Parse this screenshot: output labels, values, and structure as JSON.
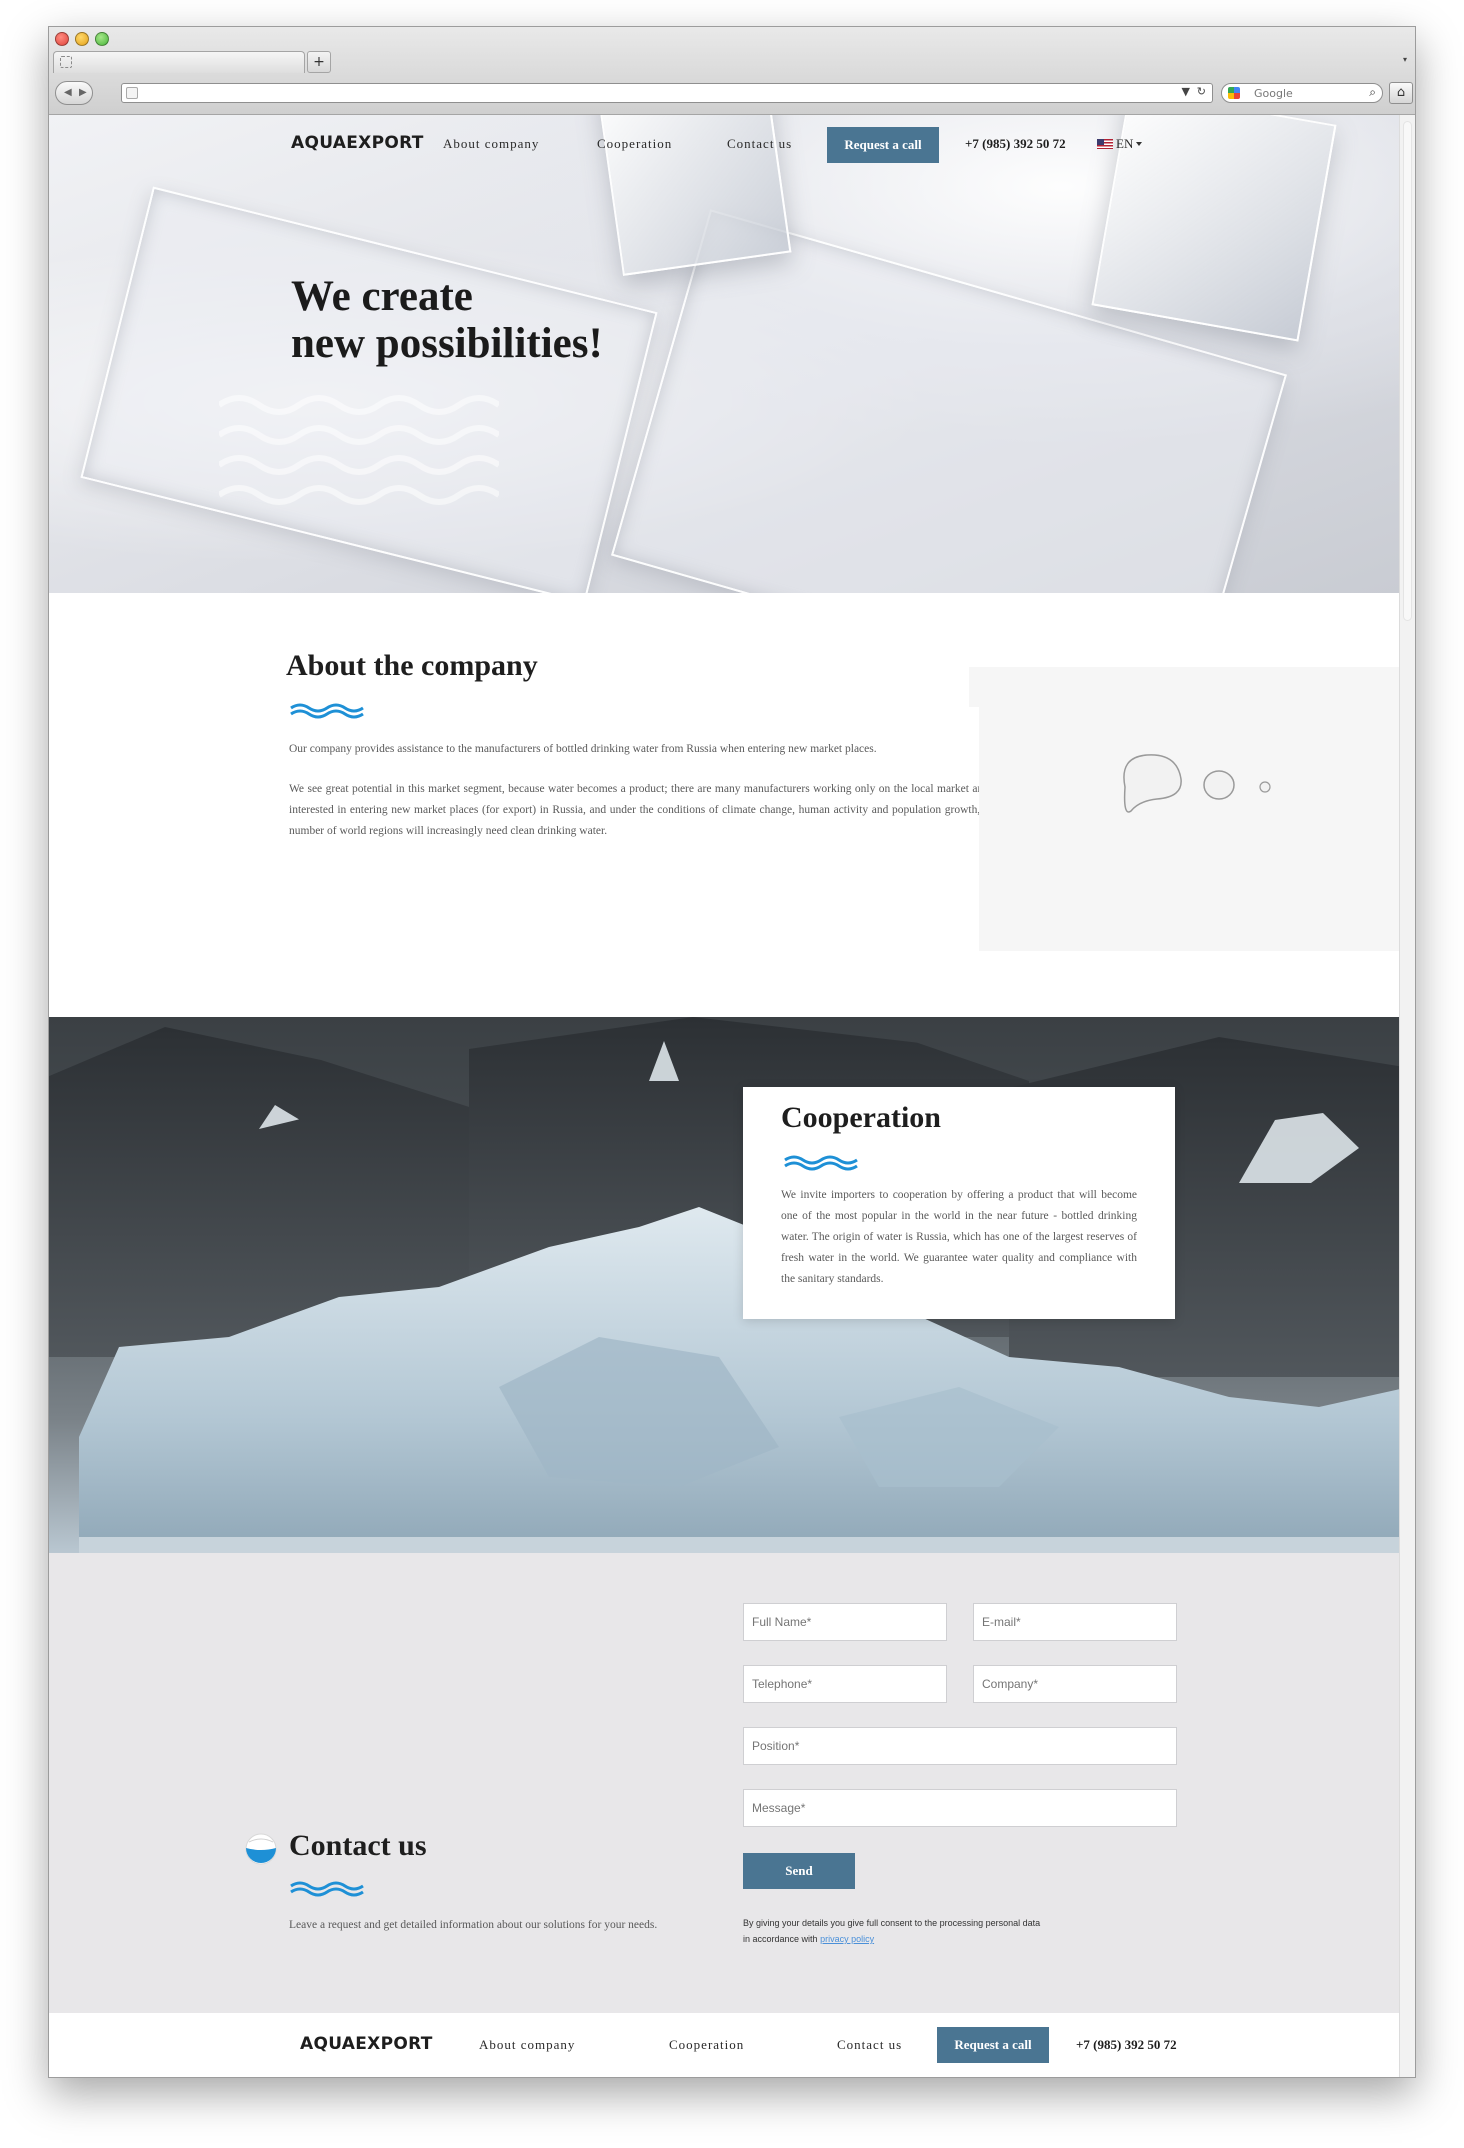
{
  "browser": {
    "new_tab_label": "+",
    "search_placeholder": "Google",
    "tab_menu_glyph": "▾",
    "back_glyph": "◀",
    "forward_glyph": "▶",
    "dropdown_glyph": "▼",
    "reload_glyph": "↻",
    "search_glyph": "⌕",
    "home_glyph": "⌂"
  },
  "header": {
    "logo": "AQUAEXPORT",
    "nav": [
      "About company",
      "Cooperation",
      "Contact us"
    ],
    "request_button": "Request a call",
    "phone": "+7 (985) 392 50 72",
    "language": "EN"
  },
  "hero": {
    "title_line1": "We create",
    "title_line2": "new possibilities!"
  },
  "about": {
    "title": "About the company",
    "paragraph1": "Our company provides assistance to the manufacturers of bottled drinking water from Russia when entering new market places.",
    "paragraph2": "We see great potential in this market segment, because water becomes a product; there are many manufacturers working only on the local market and interested in entering new market places (for export) in Russia, and under the conditions of climate change, human activity and population growth, a number of world regions will increasingly need clean drinking water."
  },
  "cooperation": {
    "title": "Cooperation",
    "text": "We invite importers to cooperation by offering a product that will become one of the most popular in the world in the near future - bottled drinking water. The origin of water is Russia, which has one of the largest reserves of fresh water in the world. We guarantee water quality and compliance with the sanitary standards."
  },
  "contact": {
    "title": "Contact us",
    "description": "Leave a request and get detailed information about our solutions for your needs.",
    "placeholders": {
      "full_name": "Full Name*",
      "email": "E-mail*",
      "telephone": "Telephone*",
      "company": "Company*",
      "position": "Position*",
      "message": "Message*"
    },
    "send_button": "Send",
    "consent_text": "By giving your details you give full consent to the processing personal data in accordance with",
    "privacy_link": "privacy policy"
  },
  "footer": {
    "logo": "AQUAEXPORT",
    "nav": [
      "About company",
      "Cooperation",
      "Contact us"
    ],
    "request_button": "Request a call",
    "phone": "+7 (985) 392 50 72"
  },
  "colors": {
    "accent": "#4a7592",
    "wave_blue": "#1e90d6",
    "contact_bg": "#e8e7e9",
    "link": "#4a90d9"
  }
}
